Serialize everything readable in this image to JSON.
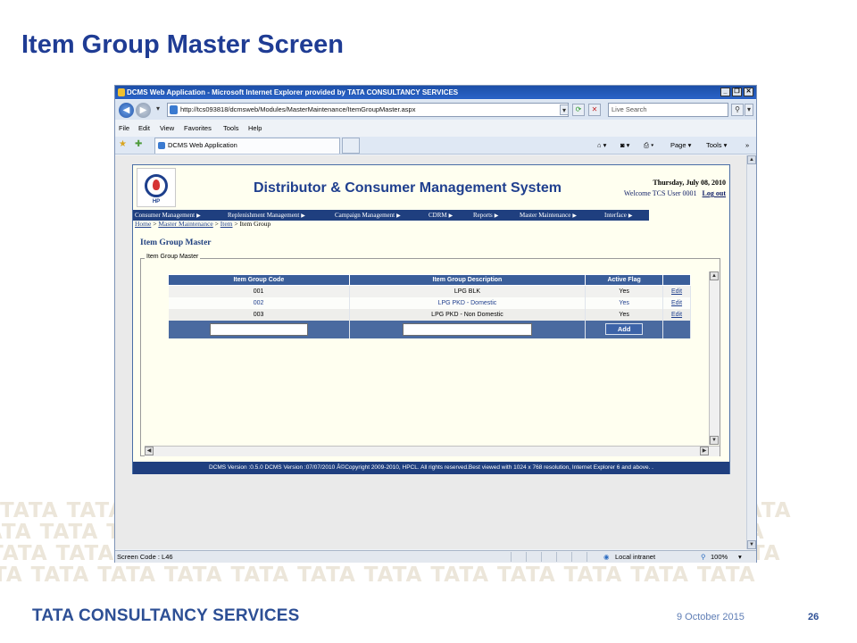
{
  "slide": {
    "title": "Item Group Master Screen",
    "brand": "TATA CONSULTANCY SERVICES",
    "date": "9 October 2015",
    "page_number": "26",
    "pattern_text": "TATA TATA TATA TATA TATA TATA TATA TATA TATA TATA TATA TATA"
  },
  "browser": {
    "title": "DCMS Web Application - Microsoft Internet Explorer provided by TATA CONSULTANCY SERVICES",
    "address": "http://tcs093818/dcmsweb/Modules/MasterMaintenance/ItemGroupMaster.aspx",
    "search_placeholder": "Live Search",
    "menu": [
      "File",
      "Edit",
      "View",
      "Favorites",
      "Tools",
      "Help"
    ],
    "tab_label": "DCMS Web Application",
    "toolbar": {
      "page": "Page",
      "tools": "Tools"
    },
    "status": {
      "left": "Screen Code : L46",
      "zone": "Local intranet",
      "zoom": "100%"
    }
  },
  "app": {
    "title": "Distributor & Consumer Management System",
    "logo_text": "HP",
    "date": "Thursday, July 08, 2010",
    "welcome": "Welcome TCS User 0001",
    "logout": "Log out",
    "nav": [
      "Consumer Management",
      "Replenishment Management",
      "Campaign Management",
      "CDRM",
      "Reports",
      "Master Maintenance",
      "Interface"
    ],
    "breadcrumb": {
      "home": "Home",
      "sep": ">",
      "master": "Master Maintenance",
      "item": "Item",
      "current": "Item Group"
    },
    "section_title": "Item Group Master",
    "fieldset_legend": "Item Group Master",
    "table": {
      "headers": [
        "Item Group Code",
        "Item Group Description",
        "Active Flag",
        ""
      ],
      "rows": [
        {
          "code": "001",
          "desc": "LPG BLK",
          "flag": "Yes",
          "action": "Edit"
        },
        {
          "code": "002",
          "desc": "LPG PKD - Domestic",
          "flag": "Yes",
          "action": "Edit"
        },
        {
          "code": "003",
          "desc": "LPG PKD - Non Domestic",
          "flag": "Yes",
          "action": "Edit"
        }
      ],
      "add_label": "Add"
    },
    "footer": "DCMS Version :0.5.0  DCMS Version :07/07/2010  Â©Copyright 2009-2010, HPCL. All rights reserved.Best viewed with 1024 x 768 resolution, Internet Explorer 6 and above. ."
  }
}
